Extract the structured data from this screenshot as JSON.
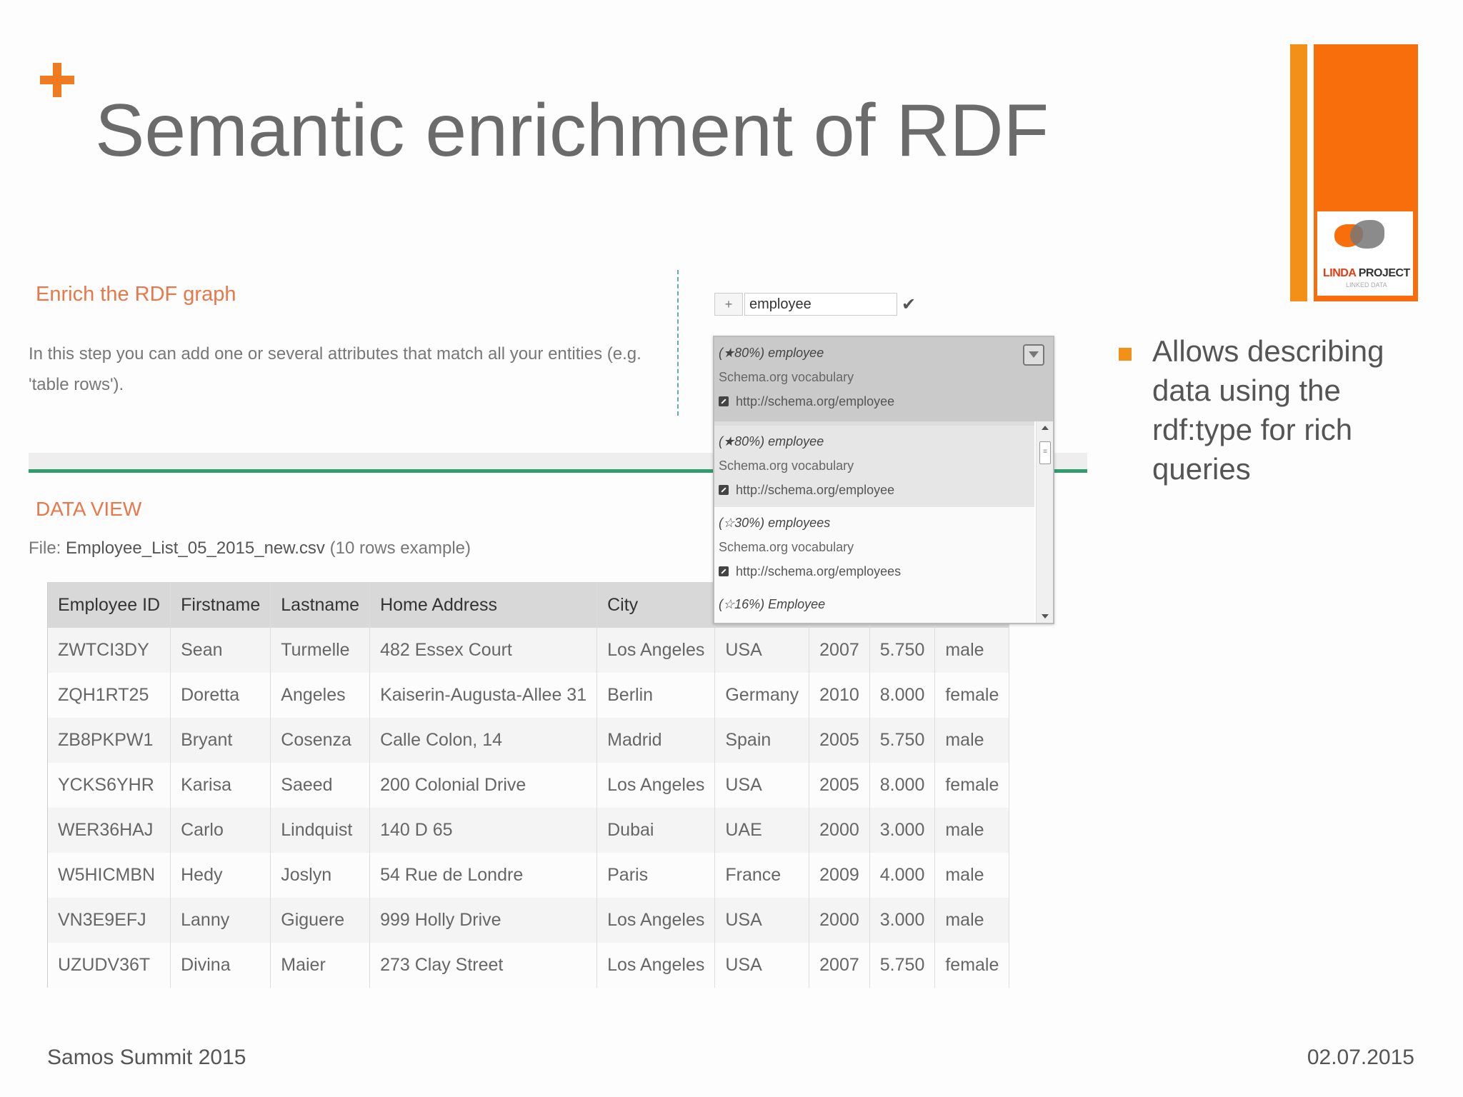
{
  "slide": {
    "title": "Semantic enrichment of RDF",
    "bullet": "Allows describing data using the rdf:type for rich queries",
    "footer_left": "Samos Summit 2015",
    "footer_right": "02.07.2015",
    "accent_color": "#f86d0c"
  },
  "logo": {
    "brand_lo": "LINDA",
    "brand_hi": "PROJECT",
    "subtitle": "LINKED DATA"
  },
  "enrich": {
    "title": "Enrich the RDF graph",
    "description": "In this step you can add one or several attributes that match all your entities (e.g. 'table rows')."
  },
  "search": {
    "add_label": "+",
    "value": "employee",
    "confirm_icon": "✔"
  },
  "suggestions": {
    "selected": {
      "match": "(★80%) employee",
      "vocab": "Schema.org vocabulary",
      "url": "http://schema.org/employee"
    },
    "items": [
      {
        "match": "(★80%) employee",
        "vocab": "Schema.org vocabulary",
        "url": "http://schema.org/employee"
      },
      {
        "match": "(☆30%) employees",
        "vocab": "Schema.org vocabulary",
        "url": "http://schema.org/employees"
      },
      {
        "match": "(☆16%) Employee",
        "vocab": "",
        "url": ""
      }
    ]
  },
  "dataview": {
    "title": "DATA VIEW",
    "file_prefix": "File:",
    "file_name": "Employee_List_05_2015_new.csv",
    "file_suffix": "(10 rows example)",
    "columns": [
      "Employee ID",
      "Firstname",
      "Lastname",
      "Home Address",
      "City",
      "",
      "",
      "",
      ""
    ],
    "rows": [
      [
        "ZWTCI3DY",
        "Sean",
        "Turmelle",
        "482 Essex Court",
        "Los Angeles",
        "USA",
        "2007",
        "5.750",
        "male"
      ],
      [
        "ZQH1RT25",
        "Doretta",
        "Angeles",
        "Kaiserin-Augusta-Allee 31",
        "Berlin",
        "Germany",
        "2010",
        "8.000",
        "female"
      ],
      [
        "ZB8PKPW1",
        "Bryant",
        "Cosenza",
        "Calle Colon, 14",
        "Madrid",
        "Spain",
        "2005",
        "5.750",
        "male"
      ],
      [
        "YCKS6YHR",
        "Karisa",
        "Saeed",
        "200 Colonial Drive",
        "Los Angeles",
        "USA",
        "2005",
        "8.000",
        "female"
      ],
      [
        "WER36HAJ",
        "Carlo",
        "Lindquist",
        "140 D 65",
        "Dubai",
        "UAE",
        "2000",
        "3.000",
        "male"
      ],
      [
        "W5HICMBN",
        "Hedy",
        "Joslyn",
        "54 Rue de Londre",
        "Paris",
        "France",
        "2009",
        "4.000",
        "male"
      ],
      [
        "VN3E9EFJ",
        "Lanny",
        "Giguere",
        "999 Holly Drive",
        "Los Angeles",
        "USA",
        "2000",
        "3.000",
        "male"
      ],
      [
        "UZUDV36T",
        "Divina",
        "Maier",
        "273 Clay Street",
        "Los Angeles",
        "USA",
        "2007",
        "5.750",
        "female"
      ]
    ]
  }
}
